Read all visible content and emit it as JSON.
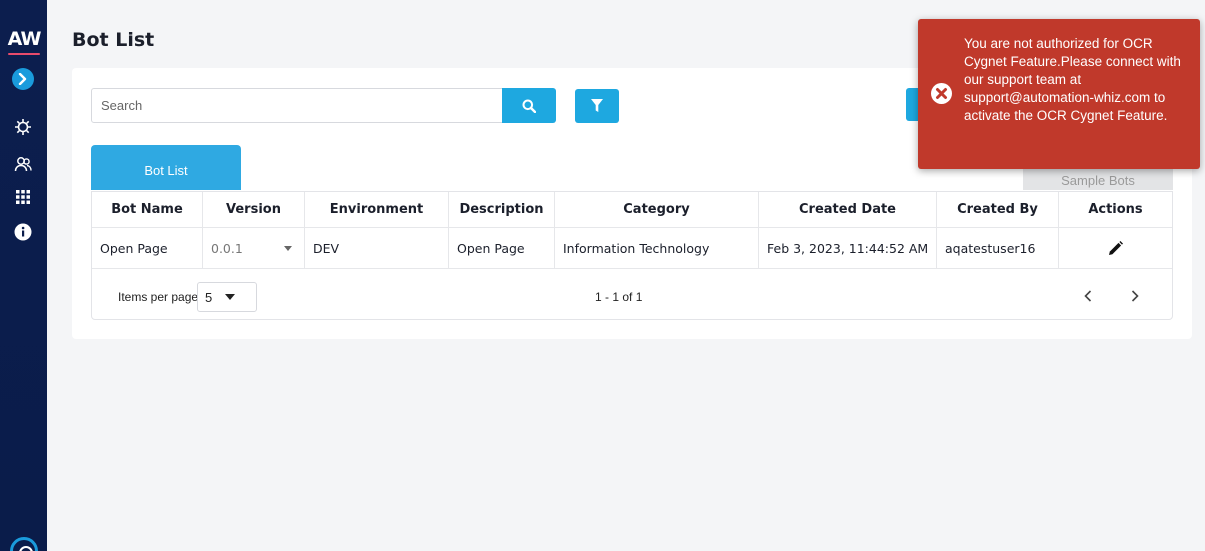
{
  "sidebar": {
    "logo_text": "AW",
    "icons": [
      "chevron-right-icon",
      "bug-settings-icon",
      "users-icon",
      "grid-icon",
      "info-icon",
      "support-icon"
    ]
  },
  "header": {
    "title": "Bot List"
  },
  "search": {
    "placeholder": "Search",
    "value": ""
  },
  "tabs": {
    "active": "Bot List",
    "sample": "Sample Bots"
  },
  "table": {
    "columns": [
      "Bot Name",
      "Version",
      "Environment",
      "Description",
      "Category",
      "Created Date",
      "Created By",
      "Actions"
    ],
    "rows": [
      {
        "bot_name": "Open Page",
        "version": "0.0.1",
        "environment": "DEV",
        "description": "Open Page",
        "category": "Information Technology",
        "created_date": "Feb 3, 2023, 11:44:52 AM",
        "created_by": "aqatestuser16"
      }
    ]
  },
  "pager": {
    "items_per_page_label": "Items per page:",
    "items_per_page": "5",
    "range": "1 - 1 of 1"
  },
  "toast": {
    "message": "You are not authorized for OCR Cygnet Feature.Please connect with our support team at support@automation-whiz.com to activate the OCR Cygnet Feature."
  },
  "colors": {
    "sidebar": "#0a1c4a",
    "accent": "#1ea8e0",
    "toast": "#c0392b"
  }
}
